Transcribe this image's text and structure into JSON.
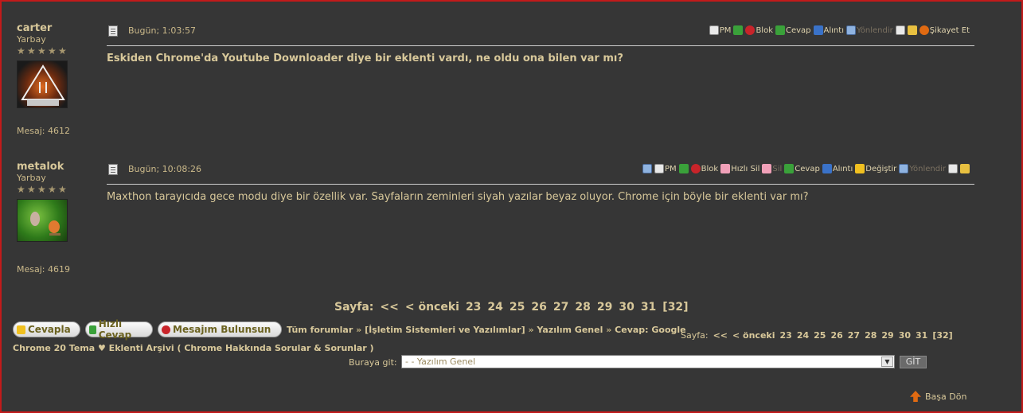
{
  "posts": [
    {
      "username": "carter",
      "rank": "Yarbay",
      "message_count": "Mesaj: 4612",
      "time": "Bugün; 1:03:57",
      "actions": [
        "PM",
        "Blok",
        "Cevap",
        "Alıntı",
        "Yönlendir",
        "Şikayet Et"
      ],
      "text": "Eskiden Chrome'da Youtube Downloader diye bir eklenti vardı, ne oldu ona bilen var mı?"
    },
    {
      "username": "metalok",
      "rank": "Yarbay",
      "message_count": "Mesaj: 4619",
      "time": "Bugün; 10:08:26",
      "actions": [
        "PM",
        "Blok",
        "Hızlı Sil",
        "Sil",
        "Cevap",
        "Alıntı",
        "Değiştir",
        "Yönlendir"
      ],
      "text": "Maxthon tarayıcıda gece modu diye bir özellik var. Sayfaların zeminleri siyah yazılar beyaz oluyor. Chrome için böyle bir eklenti var mı?"
    }
  ],
  "pager": {
    "label": "Sayfa:",
    "first": "<<",
    "prev": "< önceki",
    "pages": [
      "23",
      "24",
      "25",
      "26",
      "27",
      "28",
      "29",
      "30",
      "31"
    ],
    "current": "[32]"
  },
  "buttons": {
    "reply": "Cevapla",
    "quick_reply": "Hızlı Cevap",
    "find_message": "Mesajım Bulunsun"
  },
  "breadcrumb": {
    "all_forums": "Tüm forumlar",
    "category": "[İşletim Sistemleri ve Yazılımlar]",
    "forum": "Yazılım Genel",
    "topic_part1": "Cevap: Google",
    "topic_part2": "Chrome 20 Tema ♥ Eklenti Arşivi ( Chrome Hakkında Sorular & Sorunlar )",
    "separator": "»"
  },
  "goto": {
    "label": "Buraya git:",
    "selected": "- - Yazılım Genel",
    "button": "GİT"
  },
  "back_to_top": "Başa Dön",
  "colors": {
    "background": "#363636",
    "text": "#d8c89a",
    "frame_border": "#c21a1a"
  }
}
